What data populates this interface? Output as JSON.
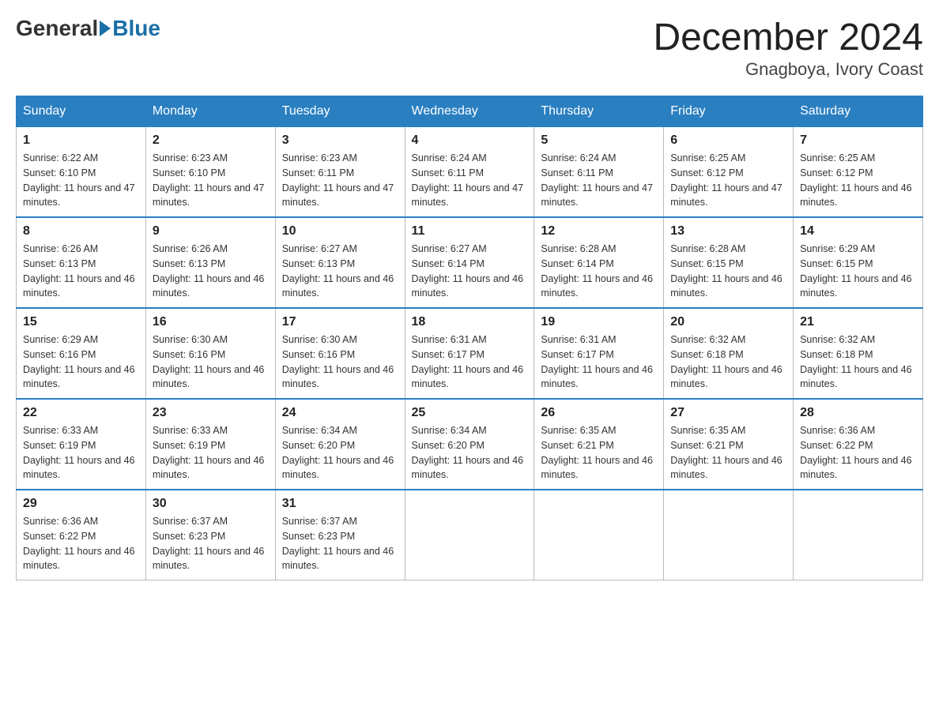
{
  "logo": {
    "general": "General",
    "blue": "Blue"
  },
  "title": "December 2024",
  "location": "Gnagboya, Ivory Coast",
  "days_header": [
    "Sunday",
    "Monday",
    "Tuesday",
    "Wednesday",
    "Thursday",
    "Friday",
    "Saturday"
  ],
  "weeks": [
    [
      {
        "day": "1",
        "sunrise": "6:22 AM",
        "sunset": "6:10 PM",
        "daylight": "11 hours and 47 minutes."
      },
      {
        "day": "2",
        "sunrise": "6:23 AM",
        "sunset": "6:10 PM",
        "daylight": "11 hours and 47 minutes."
      },
      {
        "day": "3",
        "sunrise": "6:23 AM",
        "sunset": "6:11 PM",
        "daylight": "11 hours and 47 minutes."
      },
      {
        "day": "4",
        "sunrise": "6:24 AM",
        "sunset": "6:11 PM",
        "daylight": "11 hours and 47 minutes."
      },
      {
        "day": "5",
        "sunrise": "6:24 AM",
        "sunset": "6:11 PM",
        "daylight": "11 hours and 47 minutes."
      },
      {
        "day": "6",
        "sunrise": "6:25 AM",
        "sunset": "6:12 PM",
        "daylight": "11 hours and 47 minutes."
      },
      {
        "day": "7",
        "sunrise": "6:25 AM",
        "sunset": "6:12 PM",
        "daylight": "11 hours and 46 minutes."
      }
    ],
    [
      {
        "day": "8",
        "sunrise": "6:26 AM",
        "sunset": "6:13 PM",
        "daylight": "11 hours and 46 minutes."
      },
      {
        "day": "9",
        "sunrise": "6:26 AM",
        "sunset": "6:13 PM",
        "daylight": "11 hours and 46 minutes."
      },
      {
        "day": "10",
        "sunrise": "6:27 AM",
        "sunset": "6:13 PM",
        "daylight": "11 hours and 46 minutes."
      },
      {
        "day": "11",
        "sunrise": "6:27 AM",
        "sunset": "6:14 PM",
        "daylight": "11 hours and 46 minutes."
      },
      {
        "day": "12",
        "sunrise": "6:28 AM",
        "sunset": "6:14 PM",
        "daylight": "11 hours and 46 minutes."
      },
      {
        "day": "13",
        "sunrise": "6:28 AM",
        "sunset": "6:15 PM",
        "daylight": "11 hours and 46 minutes."
      },
      {
        "day": "14",
        "sunrise": "6:29 AM",
        "sunset": "6:15 PM",
        "daylight": "11 hours and 46 minutes."
      }
    ],
    [
      {
        "day": "15",
        "sunrise": "6:29 AM",
        "sunset": "6:16 PM",
        "daylight": "11 hours and 46 minutes."
      },
      {
        "day": "16",
        "sunrise": "6:30 AM",
        "sunset": "6:16 PM",
        "daylight": "11 hours and 46 minutes."
      },
      {
        "day": "17",
        "sunrise": "6:30 AM",
        "sunset": "6:16 PM",
        "daylight": "11 hours and 46 minutes."
      },
      {
        "day": "18",
        "sunrise": "6:31 AM",
        "sunset": "6:17 PM",
        "daylight": "11 hours and 46 minutes."
      },
      {
        "day": "19",
        "sunrise": "6:31 AM",
        "sunset": "6:17 PM",
        "daylight": "11 hours and 46 minutes."
      },
      {
        "day": "20",
        "sunrise": "6:32 AM",
        "sunset": "6:18 PM",
        "daylight": "11 hours and 46 minutes."
      },
      {
        "day": "21",
        "sunrise": "6:32 AM",
        "sunset": "6:18 PM",
        "daylight": "11 hours and 46 minutes."
      }
    ],
    [
      {
        "day": "22",
        "sunrise": "6:33 AM",
        "sunset": "6:19 PM",
        "daylight": "11 hours and 46 minutes."
      },
      {
        "day": "23",
        "sunrise": "6:33 AM",
        "sunset": "6:19 PM",
        "daylight": "11 hours and 46 minutes."
      },
      {
        "day": "24",
        "sunrise": "6:34 AM",
        "sunset": "6:20 PM",
        "daylight": "11 hours and 46 minutes."
      },
      {
        "day": "25",
        "sunrise": "6:34 AM",
        "sunset": "6:20 PM",
        "daylight": "11 hours and 46 minutes."
      },
      {
        "day": "26",
        "sunrise": "6:35 AM",
        "sunset": "6:21 PM",
        "daylight": "11 hours and 46 minutes."
      },
      {
        "day": "27",
        "sunrise": "6:35 AM",
        "sunset": "6:21 PM",
        "daylight": "11 hours and 46 minutes."
      },
      {
        "day": "28",
        "sunrise": "6:36 AM",
        "sunset": "6:22 PM",
        "daylight": "11 hours and 46 minutes."
      }
    ],
    [
      {
        "day": "29",
        "sunrise": "6:36 AM",
        "sunset": "6:22 PM",
        "daylight": "11 hours and 46 minutes."
      },
      {
        "day": "30",
        "sunrise": "6:37 AM",
        "sunset": "6:23 PM",
        "daylight": "11 hours and 46 minutes."
      },
      {
        "day": "31",
        "sunrise": "6:37 AM",
        "sunset": "6:23 PM",
        "daylight": "11 hours and 46 minutes."
      },
      null,
      null,
      null,
      null
    ]
  ]
}
